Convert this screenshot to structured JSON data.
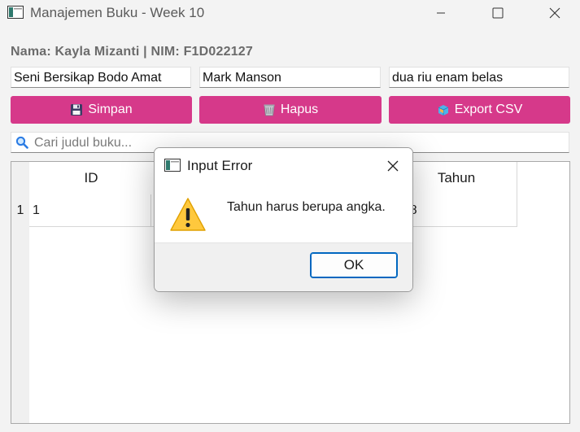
{
  "window": {
    "title": "Manajemen Buku - Week 10",
    "icon": "app-window-icon"
  },
  "header": {
    "student_label": "Nama: Kayla Mizanti | NIM: F1D022127"
  },
  "form": {
    "judul_value": "Seni Bersikap Bodo Amat",
    "penulis_value": "Mark Manson",
    "tahun_value": "dua riu enam belas"
  },
  "buttons": {
    "simpan": {
      "label": "Simpan",
      "icon": "floppy-disk-icon"
    },
    "hapus": {
      "label": "Hapus",
      "icon": "trash-icon"
    },
    "export": {
      "label": "Export CSV",
      "icon": "box-icon"
    },
    "color": "#d6398a"
  },
  "search": {
    "placeholder": "Cari judul buku...",
    "icon": "search-icon"
  },
  "table": {
    "columns": {
      "id": "ID",
      "tahun": "Tahun"
    },
    "rows": [
      {
        "row_number": "1",
        "id": "1",
        "tahun_partial": "018"
      }
    ]
  },
  "dialog": {
    "title": "Input Error",
    "message": "Tahun harus berupa angka.",
    "ok_label": "OK",
    "icon": "warning-icon"
  }
}
